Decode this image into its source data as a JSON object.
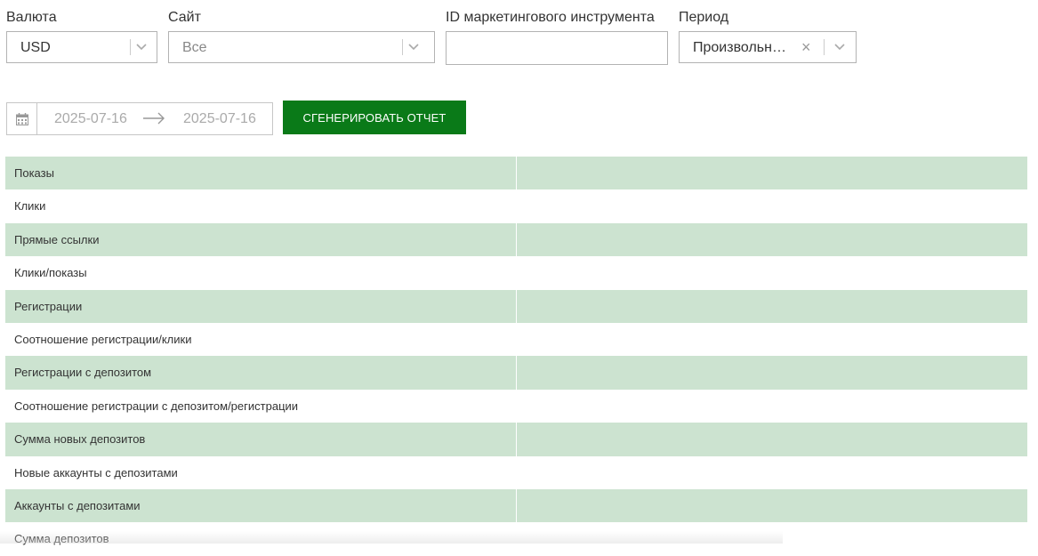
{
  "filters": {
    "currency": {
      "label": "Валюта",
      "value": "USD"
    },
    "site": {
      "label": "Сайт",
      "value": "Все"
    },
    "marketing_id": {
      "label": "ID маркетингового инструмента",
      "value": ""
    },
    "period": {
      "label": "Период",
      "value": "Произвольн…"
    }
  },
  "date_range": {
    "start": "2025-07-16",
    "end": "2025-07-16"
  },
  "generate_button": "СГЕНЕРИРОВАТЬ ОТЧЕТ",
  "report_rows": [
    "Показы",
    "Клики",
    "Прямые ссылки",
    "Клики/показы",
    "Регистрации",
    "Соотношение регистрации/клики",
    "Регистрации с депозитом",
    "Соотношение регистрации с депозитом/регистрации",
    "Сумма новых депозитов",
    "Новые аккаунты с депозитами",
    "Аккаунты с депозитами",
    "Сумма депозитов"
  ],
  "colors": {
    "accent": "#0a7a18",
    "row_shade": "#cce3d0"
  }
}
